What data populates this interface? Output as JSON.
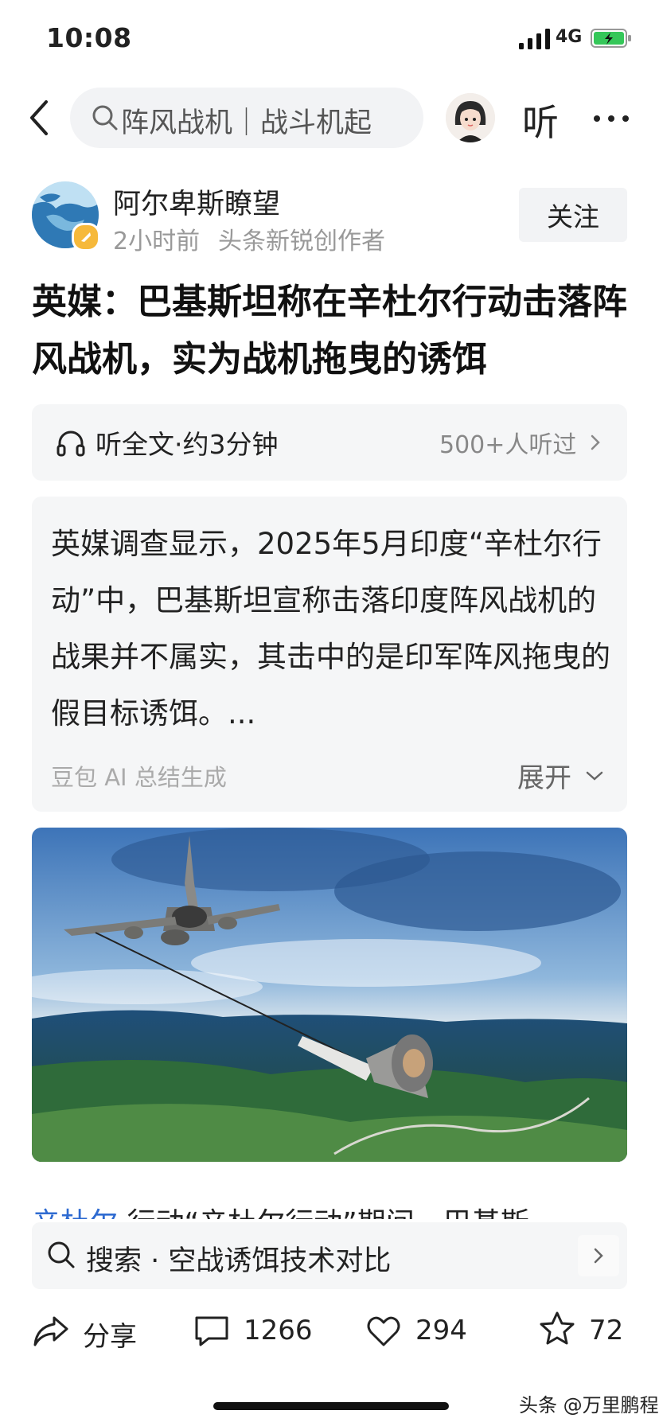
{
  "status": {
    "time": "10:08",
    "network": "4G"
  },
  "nav": {
    "search_text": "阵风战机｜战斗机起",
    "listen": "听"
  },
  "author": {
    "name": "阿尔卑斯瞭望",
    "time": "2小时前",
    "role": "头条新锐创作者",
    "follow": "关注"
  },
  "article": {
    "title": "英媒：巴基斯坦称在辛杜尔行动击落阵风战机，实为战机拖曳的诱饵",
    "listen_full": "听全文·约3分钟",
    "listeners": "500+人听过"
  },
  "summary": {
    "text": "英媒调查显示，2025年5月印度“辛杜尔行动”中，巴基斯坦宣称击落印度阵风战机的战果并不属实，其击中的是印军阵风拖曳的假目标诱饵。...",
    "source": "豆包 AI 总结生成",
    "expand": "展开"
  },
  "peek": {
    "link": "辛杜尔",
    "rest": " 行动“辛杜尔行动”期间，巴基斯"
  },
  "search_suggestion": {
    "text": "搜索 · 空战诱饵技术对比"
  },
  "actions": {
    "share": "分享",
    "comments": "1266",
    "likes": "294",
    "favorites": "72"
  },
  "watermark": "头条 @万里鹏程",
  "colors": {
    "accent": "#2f6bd1",
    "card_bg": "#f5f6f7",
    "battery": "#35c759",
    "badge": "#f6b93b"
  }
}
